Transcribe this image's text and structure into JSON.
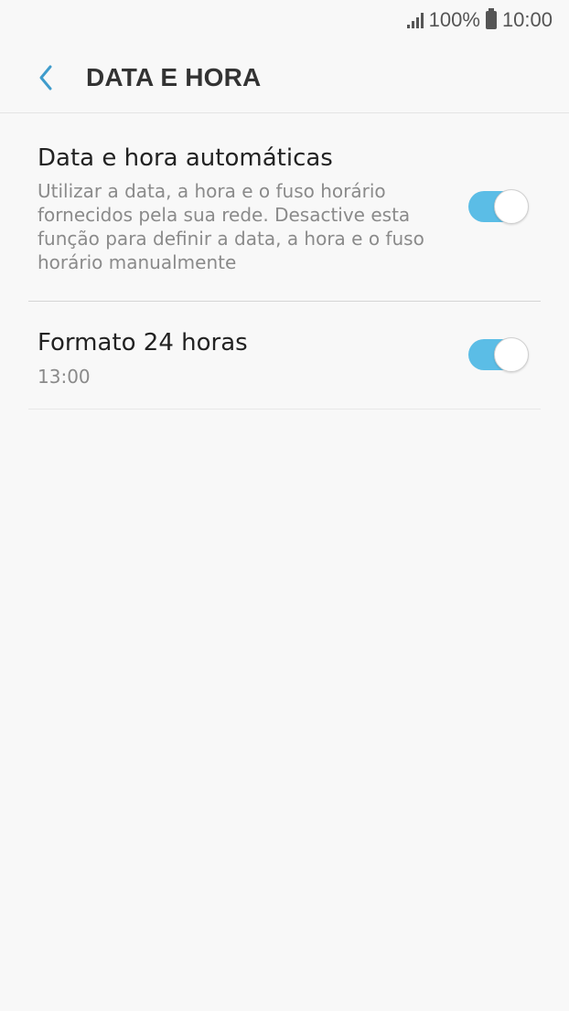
{
  "status_bar": {
    "battery_percent": "100%",
    "time": "10:00",
    "icons": [
      "signal-icon",
      "battery-icon"
    ]
  },
  "header": {
    "title": "DATA E HORA",
    "back_icon": "chevron-left-icon"
  },
  "settings": [
    {
      "title": "Data e hora automáticas",
      "description": "Utilizar a data, a hora e o fuso horário fornecidos pela sua rede. Desactive esta função para definir a data, a hora e o fuso horário manualmente",
      "enabled": true
    },
    {
      "title": "Formato 24 horas",
      "subtitle": "13:00",
      "enabled": true
    }
  ],
  "colors": {
    "accent": "#5bbde6",
    "background": "#f8f8f8"
  }
}
